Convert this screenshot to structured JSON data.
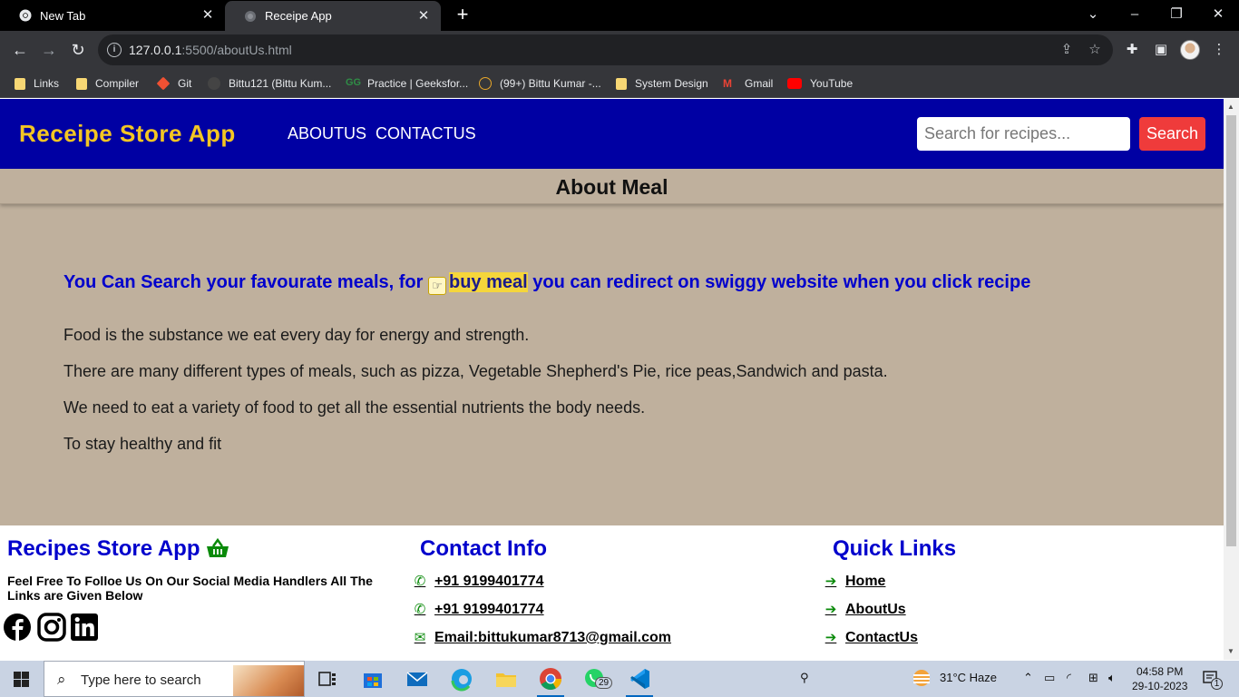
{
  "browser": {
    "tabs": [
      {
        "title": "New Tab",
        "active": false
      },
      {
        "title": "Receipe App",
        "active": true
      }
    ],
    "url_host": "127.0.0.1",
    "url_path": ":5500/aboutUs.html",
    "bookmarks": [
      "Links",
      "Compiler",
      "Git",
      "Bittu121 (Bittu Kum...",
      "Practice | Geeksfor...",
      "(99+) Bittu Kumar -...",
      "System Design",
      "Gmail",
      "YouTube"
    ]
  },
  "app": {
    "brand": "Receipe Store App",
    "nav": [
      "ABOUTUS",
      "CONTACTUS"
    ],
    "search_placeholder": "Search for recipes...",
    "search_button": "Search"
  },
  "about": {
    "title": "About Meal",
    "headline_start": "You Can Search your favourate meals, for",
    "headline_highlight": "buy meal",
    "headline_end": "you can redirect on swiggy website when you click recipe",
    "paragraphs": [
      "Food is the substance we eat every day for energy and strength.",
      "There are many different types of meals, such as pizza, Vegetable Shepherd's Pie, rice peas,Sandwich and pasta.",
      "We need to eat a variety of food to get all the essential nutrients the body needs.",
      "To stay healthy and fit"
    ]
  },
  "footer": {
    "brand_title": "Recipes Store App",
    "social_text": "Feel Free To Folloe Us On Our Social Media Handlers All The Links are Given Below",
    "social_icons": [
      "facebook-icon",
      "instagram-icon",
      "linkedin-icon"
    ],
    "contact_title": "Contact Info",
    "contacts": [
      "+91 9199401774",
      "+91 9199401774",
      "Email:bittukumar8713@gmail.com"
    ],
    "quick_title": "Quick Links",
    "quick_links": [
      "Home",
      "AboutUs",
      "ContactUs"
    ],
    "accent_color": "#0000cc",
    "icon_color": "#0a8a0a"
  },
  "taskbar": {
    "search_placeholder": "Type here to search",
    "whatsapp_badge": "29",
    "weather": "31°C  Haze",
    "time": "04:58 PM",
    "date": "29-10-2023",
    "notification_count": "1"
  }
}
